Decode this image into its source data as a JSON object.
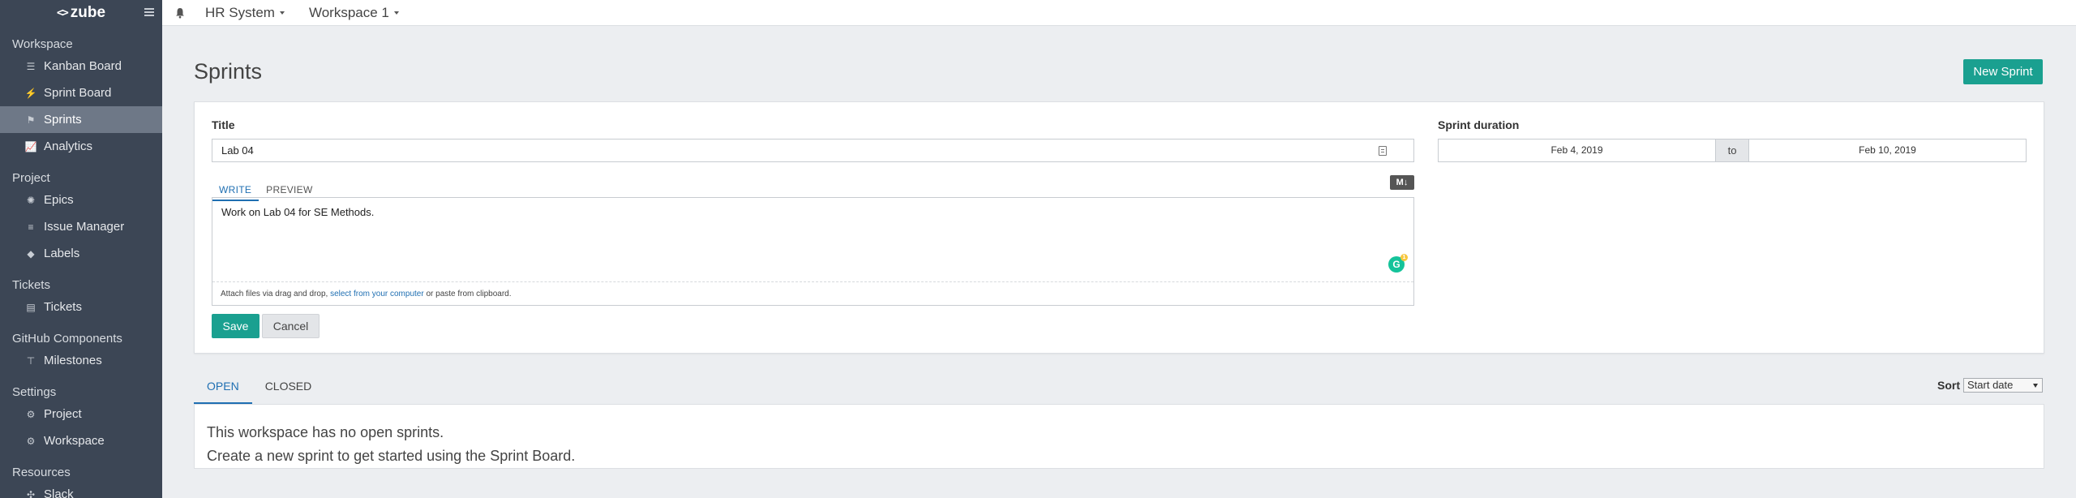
{
  "app": {
    "brand": "zube"
  },
  "sidebar": {
    "sections": [
      {
        "title": "Workspace",
        "items": [
          {
            "label": "Kanban Board",
            "icon": "kanban-icon"
          },
          {
            "label": "Sprint Board",
            "icon": "sprint-board-icon"
          },
          {
            "label": "Sprints",
            "icon": "flag-icon",
            "active": true
          },
          {
            "label": "Analytics",
            "icon": "chart-icon"
          }
        ]
      },
      {
        "title": "Project",
        "items": [
          {
            "label": "Epics",
            "icon": "epics-icon"
          },
          {
            "label": "Issue Manager",
            "icon": "list-icon"
          },
          {
            "label": "Labels",
            "icon": "tag-icon"
          }
        ]
      },
      {
        "title": "Tickets",
        "items": [
          {
            "label": "Tickets",
            "icon": "tickets-icon"
          }
        ]
      },
      {
        "title": "GitHub Components",
        "items": [
          {
            "label": "Milestones",
            "icon": "milestone-icon"
          }
        ]
      },
      {
        "title": "Settings",
        "items": [
          {
            "label": "Project",
            "icon": "gear-icon"
          },
          {
            "label": "Workspace",
            "icon": "gear-icon"
          }
        ]
      },
      {
        "title": "Resources",
        "items": [
          {
            "label": "Slack",
            "icon": "slack-icon"
          }
        ]
      }
    ]
  },
  "topbar": {
    "project": "HR System",
    "workspace": "Workspace 1"
  },
  "page": {
    "title": "Sprints",
    "new_button": "New Sprint"
  },
  "form": {
    "title_label": "Title",
    "title_value": "Lab 04",
    "write_tab": "WRITE",
    "preview_tab": "PREVIEW",
    "markdown_badge": "M↓",
    "description": "Work on Lab 04 for SE Methods.",
    "attach_prefix": "Attach files via drag and drop, ",
    "attach_link": "select from your computer",
    "attach_suffix": " or paste from clipboard.",
    "grammarly_badge": "G",
    "grammarly_count": "1",
    "save": "Save",
    "cancel": "Cancel",
    "duration_label": "Sprint duration",
    "start_date": "Feb 4, 2019",
    "to": "to",
    "end_date": "Feb 10, 2019"
  },
  "list": {
    "tab_open": "OPEN",
    "tab_closed": "CLOSED",
    "sort_label": "Sort",
    "sort_value": "Start date",
    "empty_line1": "This workspace has no open sprints.",
    "empty_line2": "Create a new sprint to get started using the Sprint Board."
  },
  "colors": {
    "sidebar": "#3c4655",
    "accent": "#1aa090",
    "link": "#1f6fb2"
  }
}
